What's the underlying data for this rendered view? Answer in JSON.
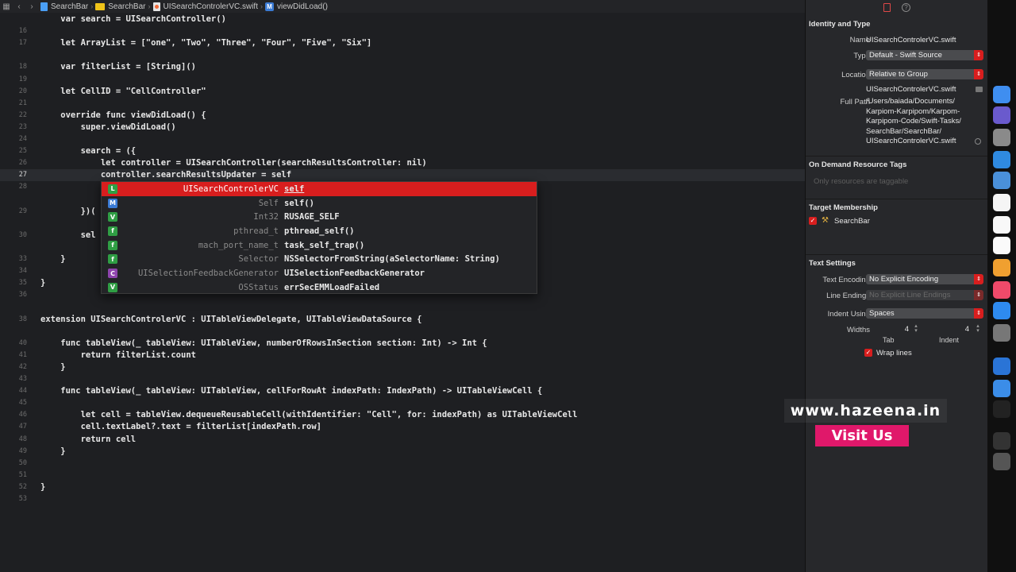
{
  "jumpbar": {
    "crumbs": [
      "SearchBar",
      "SearchBar",
      "UISearchControlerVC.swift",
      "viewDidLoad()"
    ],
    "method_badge": "M"
  },
  "editor": {
    "current_line": "27",
    "lines": [
      {
        "n": "",
        "t": "    var search = UISearchController()"
      },
      {
        "n": "16",
        "t": ""
      },
      {
        "n": "17",
        "t": "    let ArrayList = [\"one\", \"Two\", \"Three\", \"Four\", \"Five\", \"Six\"]"
      },
      {
        "n": "",
        "t": ""
      },
      {
        "n": "18",
        "t": "    var filterList = [String]()"
      },
      {
        "n": "19",
        "t": ""
      },
      {
        "n": "20",
        "t": "    let CellID = \"CellController\""
      },
      {
        "n": "21",
        "t": ""
      },
      {
        "n": "22",
        "t": "    override func viewDidLoad() {"
      },
      {
        "n": "23",
        "t": "        super.viewDidLoad()"
      },
      {
        "n": "24",
        "t": ""
      },
      {
        "n": "25",
        "t": "        search = ({"
      },
      {
        "n": "26",
        "t": "            let controller = UISearchController(searchResultsController: nil)"
      },
      {
        "n": "27",
        "t": "            controller.searchResultsUpdater = self"
      },
      {
        "n": "28",
        "t": ""
      },
      {
        "n": "",
        "t": ""
      },
      {
        "n": "29",
        "t": "        })("
      },
      {
        "n": "",
        "t": ""
      },
      {
        "n": "30",
        "t": "        sel"
      },
      {
        "n": "",
        "t": ""
      },
      {
        "n": "33",
        "t": "    }"
      },
      {
        "n": "34",
        "t": ""
      },
      {
        "n": "35",
        "t": "}"
      },
      {
        "n": "36",
        "t": ""
      },
      {
        "n": "",
        "t": ""
      },
      {
        "n": "38",
        "t": "extension UISearchControlerVC : UITableViewDelegate, UITableViewDataSource {"
      },
      {
        "n": "",
        "t": ""
      },
      {
        "n": "40",
        "t": "    func tableView(_ tableView: UITableView, numberOfRowsInSection section: Int) -> Int {"
      },
      {
        "n": "41",
        "t": "        return filterList.count"
      },
      {
        "n": "42",
        "t": "    }"
      },
      {
        "n": "43",
        "t": ""
      },
      {
        "n": "44",
        "t": "    func tableView(_ tableView: UITableView, cellForRowAt indexPath: IndexPath) -> UITableViewCell {"
      },
      {
        "n": "45",
        "t": ""
      },
      {
        "n": "46",
        "t": "        let cell = tableView.dequeueReusableCell(withIdentifier: \"Cell\", for: indexPath) as UITableViewCell"
      },
      {
        "n": "47",
        "t": "        cell.textLabel?.text = filterList[indexPath.row]"
      },
      {
        "n": "48",
        "t": "        return cell"
      },
      {
        "n": "49",
        "t": "    }"
      },
      {
        "n": "50",
        "t": ""
      },
      {
        "n": "51",
        "t": ""
      },
      {
        "n": "52",
        "t": "}"
      },
      {
        "n": "53",
        "t": ""
      }
    ]
  },
  "autocomplete": {
    "items": [
      {
        "badge": "L",
        "badge_color": "#2f9e44",
        "type": "UISearchControlerVC",
        "name": "self",
        "selected": true
      },
      {
        "badge": "M",
        "badge_color": "#3a7bd5",
        "type": "Self",
        "name": "self()",
        "selected": false
      },
      {
        "badge": "V",
        "badge_color": "#2f9e44",
        "type": "Int32",
        "name": "RUSAGE_SELF",
        "selected": false
      },
      {
        "badge": "f",
        "badge_color": "#2f9e44",
        "type": "pthread_t",
        "name": "pthread_self()",
        "selected": false
      },
      {
        "badge": "f",
        "badge_color": "#2f9e44",
        "type": "mach_port_name_t",
        "name": "task_self_trap()",
        "selected": false
      },
      {
        "badge": "f",
        "badge_color": "#2f9e44",
        "type": "Selector",
        "name": "NSSelectorFromString(aSelectorName: String)",
        "selected": false
      },
      {
        "badge": "C",
        "badge_color": "#8e44ad",
        "type": "UISelectionFeedbackGenerator",
        "name": "UISelectionFeedbackGenerator",
        "selected": false
      },
      {
        "badge": "V",
        "badge_color": "#2f9e44",
        "type": "OSStatus",
        "name": "errSecEMMLoadFailed",
        "selected": false
      }
    ]
  },
  "inspector": {
    "identity": {
      "title": "Identity and Type",
      "name_label": "Name",
      "name_value": "UISearchControlerVC.swift",
      "type_label": "Type",
      "type_value": "Default - Swift Source",
      "location_label": "Location",
      "location_value": "Relative to Group",
      "location_file": "UISearchControlerVC.swift",
      "fullpath_label": "Full Path",
      "fullpath_lines": [
        "/Users/baiada/Documents/",
        "Karpiom-Karpipom/Karpom-",
        "Karpipom-Code/Swift-Tasks/",
        "SearchBar/SearchBar/",
        "UISearchControlerVC.swift"
      ]
    },
    "odr": {
      "title": "On Demand Resource Tags",
      "hint": "Only resources are taggable"
    },
    "membership": {
      "title": "Target Membership",
      "target": "SearchBar"
    },
    "text_settings": {
      "title": "Text Settings",
      "encoding_label": "Text Encoding",
      "encoding_value": "No Explicit Encoding",
      "endings_label": "Line Endings",
      "endings_value": "No Explicit Line Endings",
      "indent_label": "Indent Using",
      "indent_value": "Spaces",
      "widths_label": "Widths",
      "tab_value": "4",
      "indent_width_value": "4",
      "tab_label": "Tab",
      "indent_sub_label": "Indent",
      "wrap_label": "Wrap lines"
    }
  },
  "dock": {
    "icons": [
      {
        "name": "finder-icon",
        "color": "#3f8ef0"
      },
      {
        "name": "siri-icon",
        "color": "#6a5acd"
      },
      {
        "name": "launchpad-icon",
        "color": "#8a8a8a"
      },
      {
        "name": "safari-icon",
        "color": "#2f8ae0"
      },
      {
        "name": "chrome-icon",
        "color": "#4a90d9"
      },
      {
        "name": "calendar-icon",
        "color": "#f5f5f5"
      },
      {
        "name": "notes-icon",
        "color": "#f8f8f8"
      },
      {
        "name": "reminders-icon",
        "color": "#fafafa"
      },
      {
        "name": "photos-icon",
        "color": "#f0a030"
      },
      {
        "name": "music-icon",
        "color": "#f04a6a"
      },
      {
        "name": "appstore-icon",
        "color": "#2e8bf0"
      },
      {
        "name": "system-preferences-icon",
        "color": "#777777"
      },
      {
        "name": "xcode-icon",
        "color": "#2a74d6"
      },
      {
        "name": "mail-icon",
        "color": "#3b8de8"
      },
      {
        "name": "terminal-icon",
        "color": "#222222"
      },
      {
        "name": "preview-icon",
        "color": "#333333"
      },
      {
        "name": "trash-icon",
        "color": "#555555"
      }
    ]
  },
  "watermark": {
    "url": "www.hazeena.in",
    "cta": "Visit Us"
  }
}
